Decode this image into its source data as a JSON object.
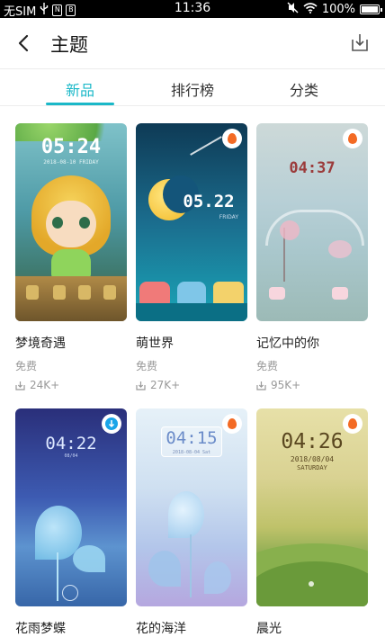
{
  "status": {
    "carrier": "无SIM",
    "time": "11:36",
    "battery": "100%",
    "icons": [
      "usb-icon",
      "notification-icon",
      "notification-icon",
      "mute-icon",
      "wifi-icon",
      "battery-icon"
    ]
  },
  "header": {
    "title": "主题",
    "back_icon": "back-arrow-icon",
    "download_icon": "download-manager-icon"
  },
  "tabs": [
    {
      "label": "新品",
      "active": true
    },
    {
      "label": "排行榜",
      "active": false
    },
    {
      "label": "分类",
      "active": false
    }
  ],
  "accent_color": "#1ab8c8",
  "themes": [
    {
      "name": "梦境奇遇",
      "price": "免费",
      "downloads": "24K+",
      "preview_clock": "05:24",
      "preview_date": "2018-08-10  FRIDAY",
      "badge": "none"
    },
    {
      "name": "萌世界",
      "price": "免费",
      "downloads": "27K+",
      "preview_clock": "05.22",
      "preview_date": "FRIDAY",
      "badge": "hot"
    },
    {
      "name": "记忆中的你",
      "price": "免费",
      "downloads": "95K+",
      "preview_clock": "04:37",
      "preview_date": "",
      "badge": "hot"
    },
    {
      "name": "花雨梦蝶",
      "price": "",
      "downloads": "",
      "preview_clock": "04:22",
      "preview_date": "08/04",
      "badge": "downloading"
    },
    {
      "name": "花的海洋",
      "price": "",
      "downloads": "",
      "preview_clock": "04:15",
      "preview_date": "2018-08-04  Sat",
      "badge": "hot"
    },
    {
      "name": "晨光",
      "price": "",
      "downloads": "",
      "preview_clock": "04:26",
      "preview_date": "2018/08/04",
      "preview_day": "SATURDAY",
      "badge": "hot"
    }
  ]
}
